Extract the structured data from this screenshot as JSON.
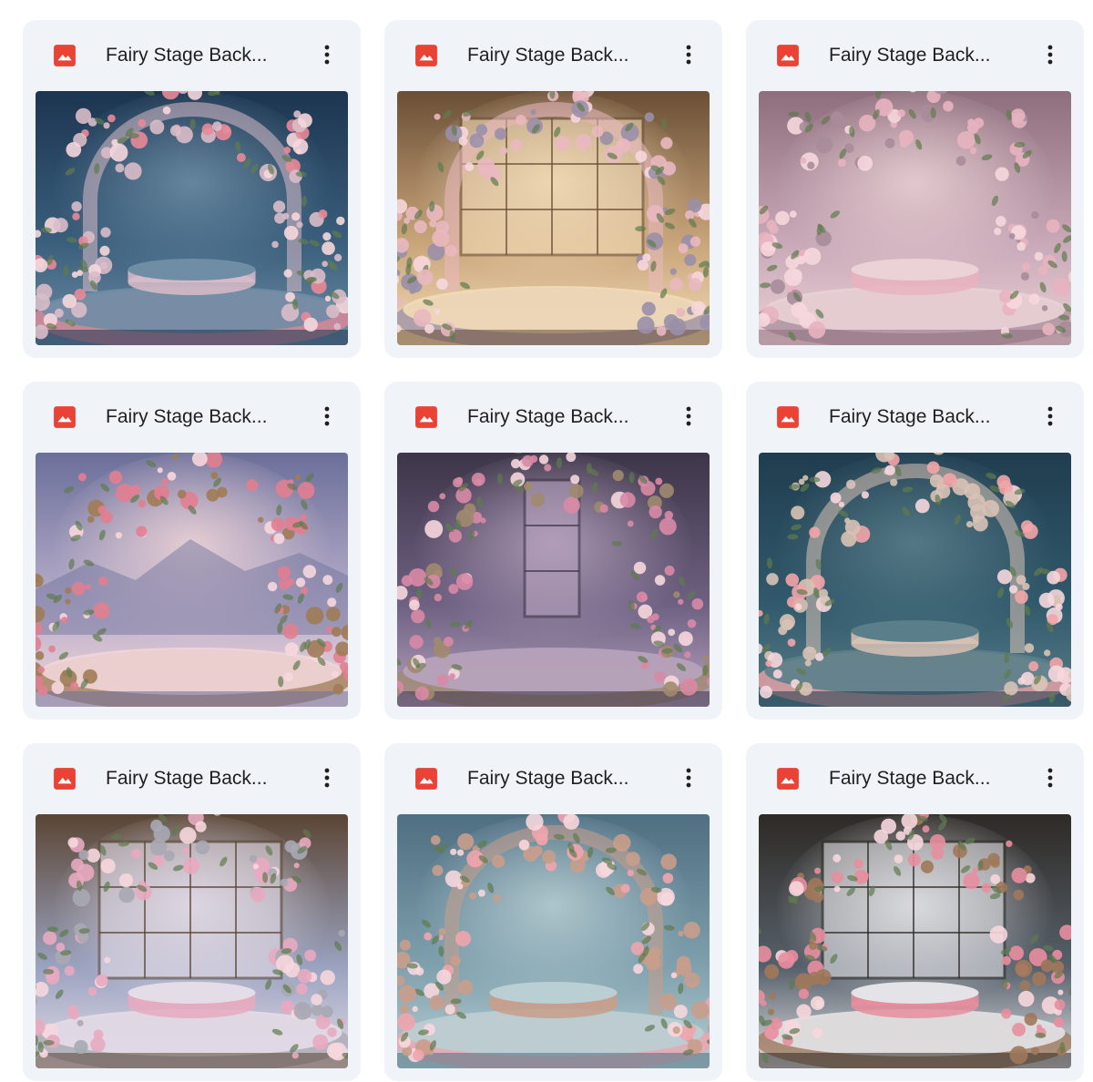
{
  "files": [
    {
      "name": "Fairy Stage Back...",
      "type_icon": "image-file-icon",
      "scene": "arch",
      "palette": [
        "#1c3550",
        "#3a5f7c",
        "#6f8ea6",
        "#d9bcc8",
        "#e88a98"
      ]
    },
    {
      "name": "Fairy Stage Back...",
      "type_icon": "image-file-icon",
      "scene": "window-arch",
      "palette": [
        "#6a4f36",
        "#c9a57a",
        "#f3dcb8",
        "#e9b8c0",
        "#9a8fa8"
      ]
    },
    {
      "name": "Fairy Stage Back...",
      "type_icon": "image-file-icon",
      "scene": "soft",
      "palette": [
        "#8e6e7c",
        "#c9a9b8",
        "#ead2d6",
        "#e8b3c0",
        "#a78c9a"
      ]
    },
    {
      "name": "Fairy Stage Back...",
      "type_icon": "image-file-icon",
      "scene": "landscape",
      "palette": [
        "#6b6f9a",
        "#b9aecb",
        "#f1d6d8",
        "#e27e90",
        "#a07b57"
      ]
    },
    {
      "name": "Fairy Stage Back...",
      "type_icon": "image-file-icon",
      "scene": "door",
      "palette": [
        "#3d3548",
        "#6e6182",
        "#b7a3bf",
        "#d88aa5",
        "#a08a6e"
      ]
    },
    {
      "name": "Fairy Stage Back...",
      "type_icon": "image-file-icon",
      "scene": "arch",
      "palette": [
        "#1f3d4f",
        "#315a6c",
        "#5b7f8a",
        "#d8c2b5",
        "#f2a5a8"
      ]
    },
    {
      "name": "Fairy Stage Back...",
      "type_icon": "image-file-icon",
      "scene": "window",
      "palette": [
        "#5a4534",
        "#9aa2bf",
        "#e4dde8",
        "#e8aac0",
        "#a8a8b2"
      ]
    },
    {
      "name": "Fairy Stage Back...",
      "type_icon": "image-file-icon",
      "scene": "arch",
      "palette": [
        "#4f6f82",
        "#7fa0ad",
        "#b9cfd4",
        "#c99d8b",
        "#f0a5ad"
      ]
    },
    {
      "name": "Fairy Stage Back...",
      "type_icon": "image-file-icon",
      "scene": "window",
      "palette": [
        "#2e2a26",
        "#56606a",
        "#e3e3e8",
        "#e88e9e",
        "#a0785a"
      ]
    }
  ],
  "colors": {
    "card_background": "#f0f4f9",
    "image_icon": "#ea4335",
    "title_text": "#1f1f1f",
    "menu_dots": "#1f1f1f"
  }
}
